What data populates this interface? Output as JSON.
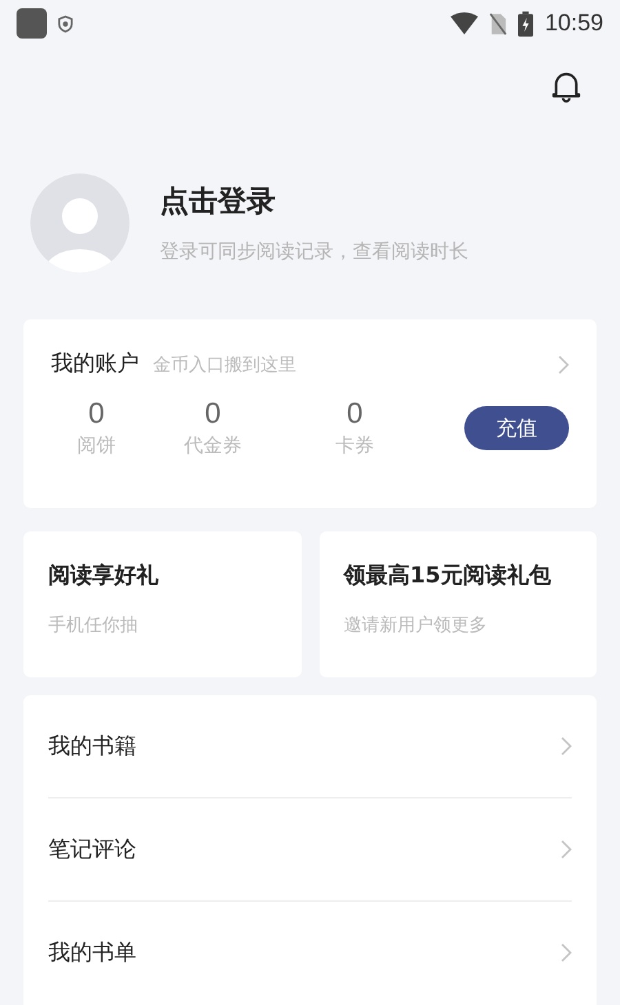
{
  "status_bar": {
    "time": "10:59"
  },
  "profile": {
    "title": "点击登录",
    "subtitle": "登录可同步阅读记录，查看阅读时长"
  },
  "account": {
    "title": "我的账户",
    "hint": "金币入口搬到这里",
    "stats": [
      {
        "value": "0",
        "label": "阅饼"
      },
      {
        "value": "0",
        "label": "代金券"
      },
      {
        "value": "0",
        "label": "卡券"
      }
    ],
    "button": "充值"
  },
  "promos": [
    {
      "title": "阅读享好礼",
      "subtitle": "手机任你抽"
    },
    {
      "title": "领最高15元阅读礼包",
      "subtitle": "邀请新用户领更多"
    }
  ],
  "menu": [
    "我的书籍",
    "笔记评论",
    "我的书单"
  ]
}
